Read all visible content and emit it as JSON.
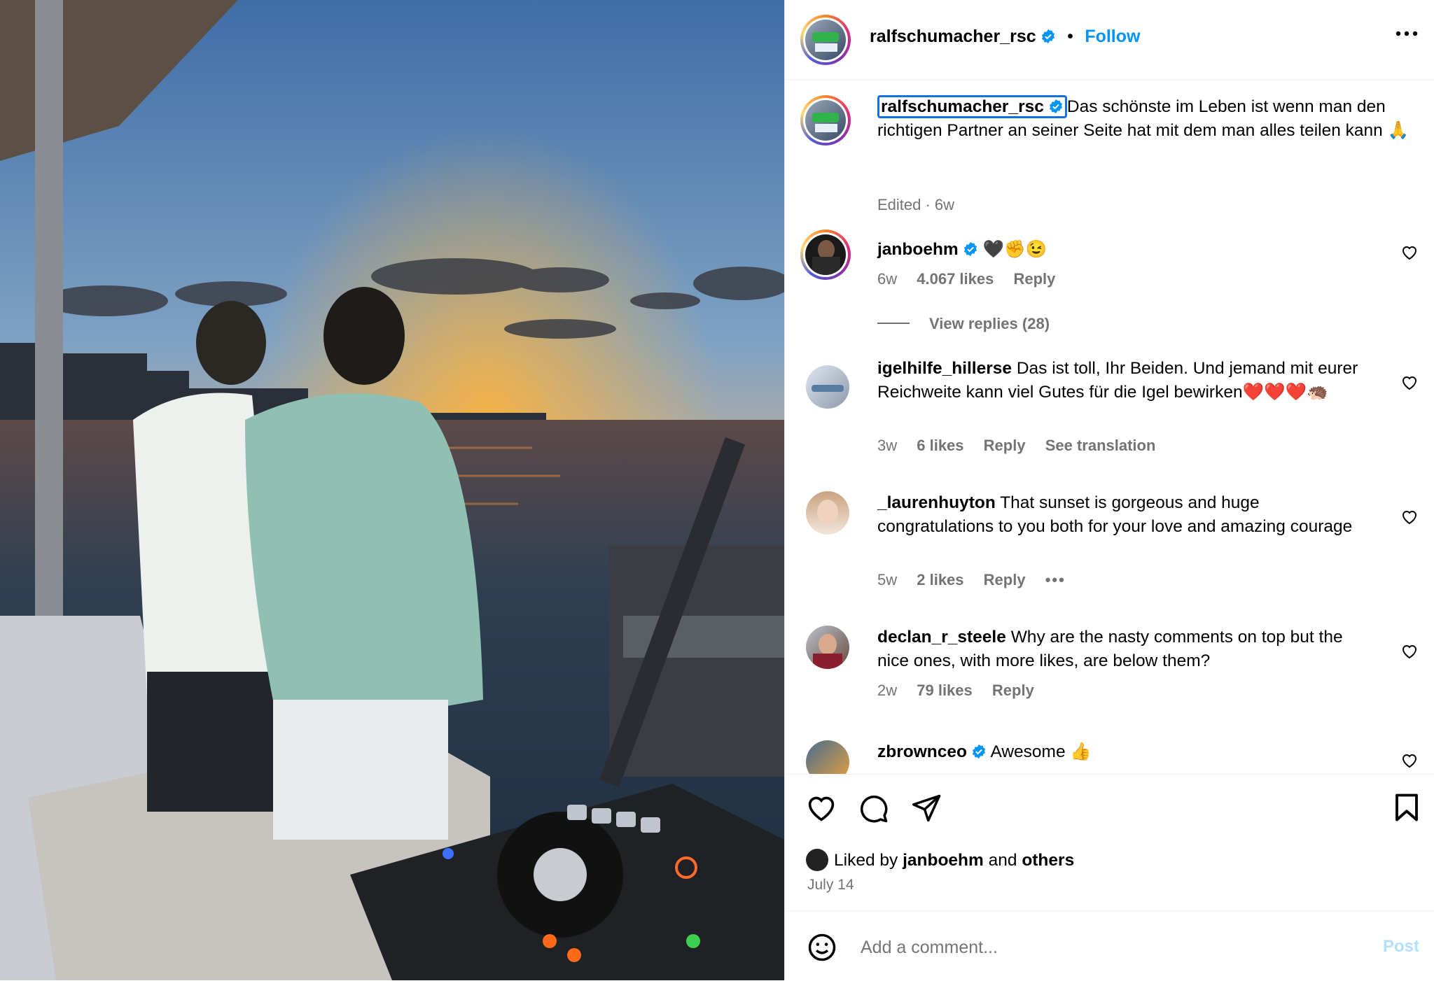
{
  "post": {
    "author": "ralfschumacher_rsc",
    "follow_label": "Follow",
    "separator": "•",
    "caption": "Das schönste im Leben ist wenn man den richtigen Partner an seiner Seite hat mit dem man alles teilen kann 🙏",
    "caption_meta": "Edited · 6w",
    "liked_by_prefix": "Liked by",
    "liked_by_user": "janboehm",
    "liked_by_and": "and",
    "liked_by_others": "others",
    "date": "July 14"
  },
  "comments": [
    {
      "user": "janboehm",
      "verified": true,
      "text": "🖤✊😉",
      "age": "6w",
      "likes": "4.067 likes",
      "reply": "Reply",
      "view_replies": "View replies (28)"
    },
    {
      "user": "igelhilfe_hillerse",
      "verified": false,
      "text": "Das ist toll, Ihr Beiden. Und jemand mit eurer Reichweite kann viel Gutes für die Igel bewirken❤️❤️❤️🦔",
      "age": "3w",
      "likes": "6 likes",
      "reply": "Reply",
      "translate": "See translation"
    },
    {
      "user": "_laurenhuyton",
      "verified": false,
      "text": "That sunset is gorgeous and huge congratulations to you both for your love and amazing courage",
      "age": "5w",
      "likes": "2 likes",
      "reply": "Reply",
      "more": "•••"
    },
    {
      "user": "declan_r_steele",
      "verified": false,
      "text": "Why are the nasty comments on top but the nice ones, with more likes, are below them?",
      "age": "2w",
      "likes": "79 likes",
      "reply": "Reply"
    },
    {
      "user": "zbrownceo",
      "verified": true,
      "text": "Awesome 👍"
    }
  ],
  "composer": {
    "placeholder": "Add a comment...",
    "post_label": "Post"
  },
  "colors": {
    "accent": "#0095f6",
    "verified": "#0095f6",
    "meta": "#737373"
  }
}
